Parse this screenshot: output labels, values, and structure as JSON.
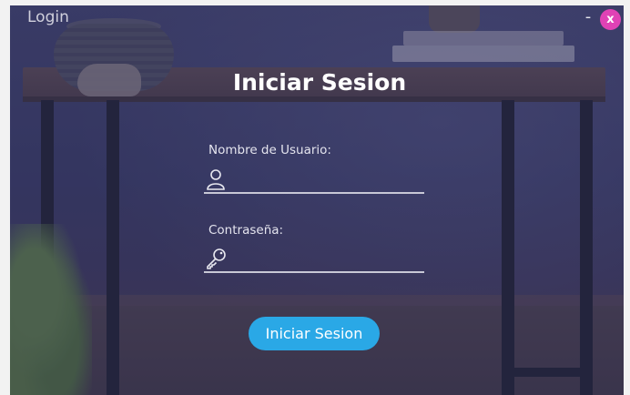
{
  "window": {
    "title": "Login",
    "minimize_label": "-",
    "close_label": "x"
  },
  "form": {
    "heading": "Iniciar Sesion",
    "username": {
      "label": "Nombre de Usuario:",
      "value": "",
      "placeholder": "",
      "icon": "user-icon"
    },
    "password": {
      "label": "Contraseña:",
      "value": "",
      "placeholder": "",
      "icon": "key-icon"
    },
    "submit_label": "Iniciar Sesion"
  },
  "colors": {
    "accent_button": "#2aa8e6",
    "close_button": "#e042b5"
  }
}
